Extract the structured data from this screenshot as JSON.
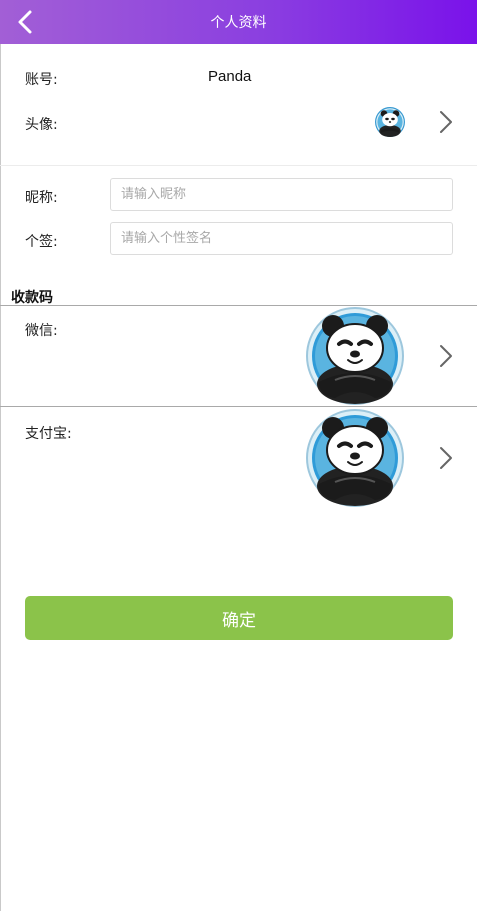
{
  "header": {
    "title": "个人资料"
  },
  "account": {
    "label": "账号:",
    "value": "Panda"
  },
  "avatar": {
    "label": "头像:"
  },
  "nickname": {
    "label": "昵称:",
    "placeholder": "请输入昵称"
  },
  "signature": {
    "label": "个签:",
    "placeholder": "请输入个性签名"
  },
  "payment": {
    "section_title": "收款码",
    "wechat_label": "微信:",
    "alipay_label": "支付宝:"
  },
  "confirm": {
    "label": "确定"
  },
  "colors": {
    "header_start": "#a25fd6",
    "header_end": "#7a12ea",
    "confirm_button": "#8bc34a"
  },
  "icons": [
    "back-arrow-icon",
    "chevron-right-icon",
    "panda-avatar-image"
  ]
}
